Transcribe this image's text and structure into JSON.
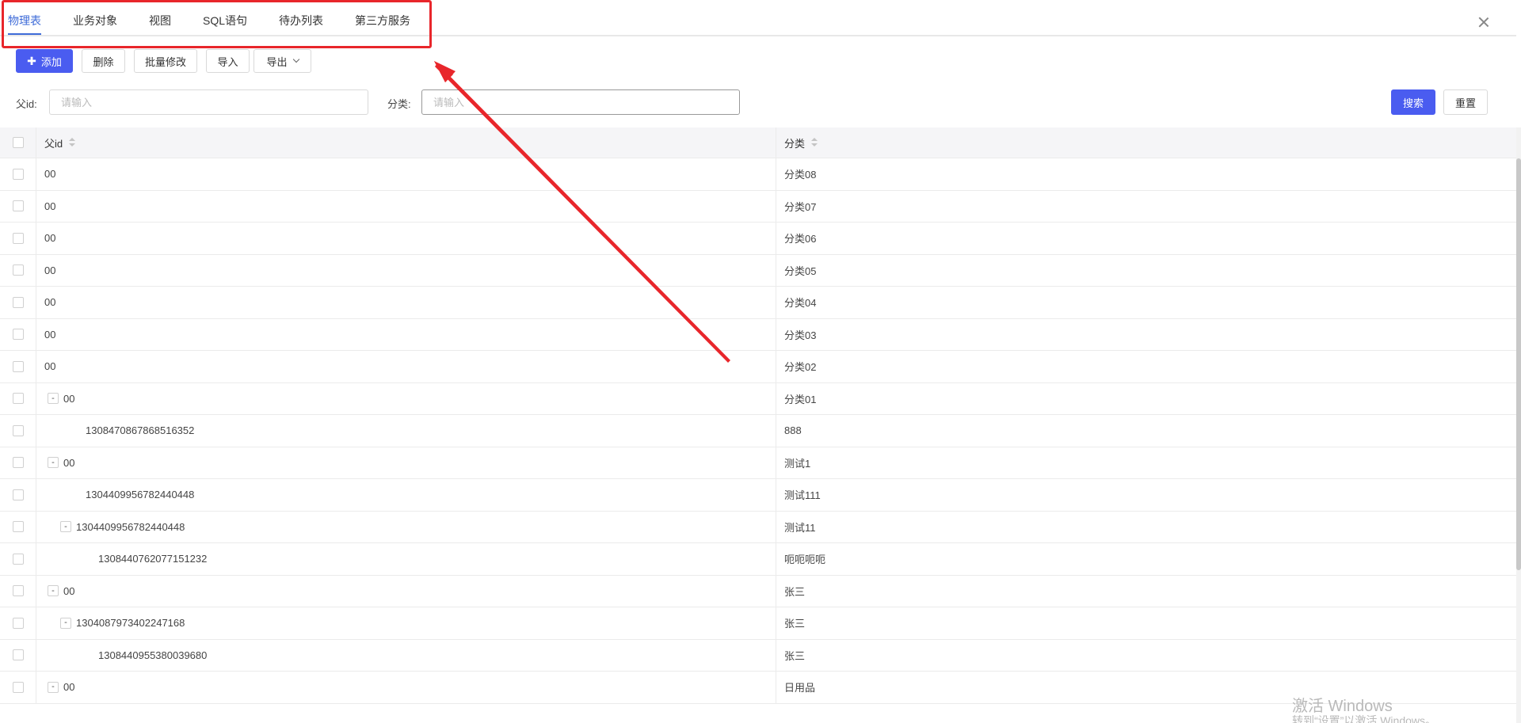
{
  "tabs": [
    {
      "label": "物理表",
      "active": true
    },
    {
      "label": "业务对象"
    },
    {
      "label": "视图"
    },
    {
      "label": "SQL语句"
    },
    {
      "label": "待办列表"
    },
    {
      "label": "第三方服务"
    }
  ],
  "toolbar": {
    "add_label": "添加",
    "delete_label": "删除",
    "batch_edit_label": "批量修改",
    "import_label": "导入",
    "export_label": "导出"
  },
  "filters": {
    "parent_id_label": "父id:",
    "parent_id_placeholder": "请输入",
    "category_label": "分类:",
    "category_placeholder": "请输入",
    "search_label": "搜索",
    "reset_label": "重置"
  },
  "table": {
    "columns": [
      "父id",
      "分类"
    ],
    "rows": [
      {
        "parent_id": "00",
        "category": "分类08",
        "indent": 0,
        "expander": ""
      },
      {
        "parent_id": "00",
        "category": "分类07",
        "indent": 0,
        "expander": ""
      },
      {
        "parent_id": "00",
        "category": "分类06",
        "indent": 0,
        "expander": ""
      },
      {
        "parent_id": "00",
        "category": "分类05",
        "indent": 0,
        "expander": ""
      },
      {
        "parent_id": "00",
        "category": "分类04",
        "indent": 0,
        "expander": ""
      },
      {
        "parent_id": "00",
        "category": "分类03",
        "indent": 0,
        "expander": ""
      },
      {
        "parent_id": "00",
        "category": "分类02",
        "indent": 0,
        "expander": ""
      },
      {
        "parent_id": "00",
        "category": "分类01",
        "indent": 0,
        "expander": "-"
      },
      {
        "parent_id": "1308470867868516352",
        "category": "888",
        "indent": 2,
        "expander": ""
      },
      {
        "parent_id": "00",
        "category": "测试1",
        "indent": 0,
        "expander": "-"
      },
      {
        "parent_id": "1304409956782440448",
        "category": "测试111",
        "indent": 2,
        "expander": ""
      },
      {
        "parent_id": "1304409956782440448",
        "category": "测试11",
        "indent": 1,
        "expander": "-"
      },
      {
        "parent_id": "1308440762077151232",
        "category": "呃呃呃呃",
        "indent": 3,
        "expander": ""
      },
      {
        "parent_id": "00",
        "category": "张三",
        "indent": 0,
        "expander": "-"
      },
      {
        "parent_id": "1304087973402247168",
        "category": "张三",
        "indent": 1,
        "expander": "-"
      },
      {
        "parent_id": "1308440955380039680",
        "category": "张三",
        "indent": 3,
        "expander": ""
      },
      {
        "parent_id": "00",
        "category": "日用品",
        "indent": 0,
        "expander": "-"
      }
    ]
  },
  "watermark": {
    "line1": "激活 Windows",
    "line2": "转到“设置”以激活 Windows。"
  },
  "colors": {
    "primary": "#4a5cf0",
    "tab_active": "#3e6bd8",
    "annotation": "#e8262b"
  }
}
